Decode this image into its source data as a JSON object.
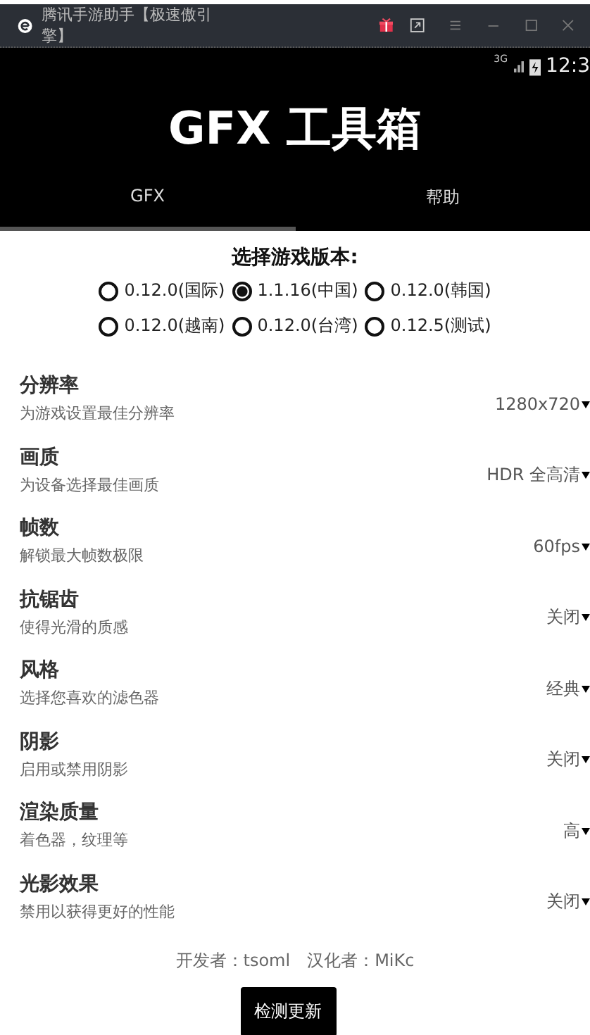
{
  "window": {
    "title": "腾讯手游助手【极速傲引擎】"
  },
  "status_bar": {
    "network": "3G",
    "time": "12:3"
  },
  "app_title": "GFX 工具箱",
  "tabs": [
    {
      "label": "GFX",
      "selected": true
    },
    {
      "label": "帮助",
      "selected": false
    }
  ],
  "version_picker": {
    "label": "选择游戏版本:",
    "options": [
      {
        "label": "0.12.0(国际)",
        "selected": false
      },
      {
        "label": "1.1.16(中国)",
        "selected": true
      },
      {
        "label": "0.12.0(韩国)",
        "selected": false
      },
      {
        "label": "0.12.0(越南)",
        "selected": false
      },
      {
        "label": "0.12.0(台湾)",
        "selected": false
      },
      {
        "label": "0.12.5(测试)",
        "selected": false
      }
    ]
  },
  "settings": [
    {
      "title": "分辨率",
      "subtitle": "为游戏设置最佳分辨率",
      "value": "1280x720"
    },
    {
      "title": "画质",
      "subtitle": "为设备选择最佳画质",
      "value": "HDR 全高清"
    },
    {
      "title": "帧数",
      "subtitle": "解锁最大帧数极限",
      "value": "60fps"
    },
    {
      "title": "抗锯齿",
      "subtitle": "使得光滑的质感",
      "value": "关闭"
    },
    {
      "title": "风格",
      "subtitle": "选择您喜欢的滤色器",
      "value": "经典"
    },
    {
      "title": "阴影",
      "subtitle": "启用或禁用阴影",
      "value": "关闭"
    },
    {
      "title": "渲染质量",
      "subtitle": "着色器，纹理等",
      "value": "高"
    },
    {
      "title": "光影效果",
      "subtitle": "禁用以获得更好的性能",
      "value": "关闭"
    }
  ],
  "footer": {
    "credits": "开发者：tsoml　汉化者：MiKc",
    "button": "检测更新"
  }
}
